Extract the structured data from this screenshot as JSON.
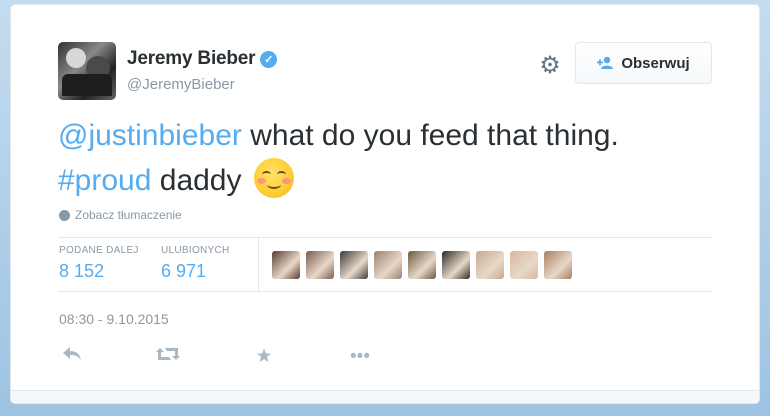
{
  "profile": {
    "display_name": "Jeremy Bieber",
    "handle": "@JeremyBieber",
    "verified": true,
    "verified_icon": "✓"
  },
  "follow_button": {
    "label": "Obserwuj",
    "icon": "add-user-icon"
  },
  "tweet": {
    "mention": "@justinbieber",
    "text_part1": " what do you feed that thing.",
    "hashtag": "#proud",
    "text_part2": " daddy ",
    "emoji": "smiling-face-with-blush"
  },
  "translate_link": "Zobacz tłumaczenie",
  "stats": {
    "retweets_label": "PODANE DALEJ",
    "retweets_value": "8 152",
    "likes_label": "ULUBIONYCH",
    "likes_value": "6 971"
  },
  "favoriters_colors": [
    "#5a3a32",
    "#7a5a50",
    "#3a3a3a",
    "#9a8070",
    "#6a5a40",
    "#2a2a2a",
    "#c8a890",
    "#d8b8a0",
    "#a88060"
  ],
  "timestamp": "08:30 - 9.10.2015",
  "colors": {
    "accent": "#55acee",
    "text": "#292f33",
    "muted": "#8899a6"
  }
}
